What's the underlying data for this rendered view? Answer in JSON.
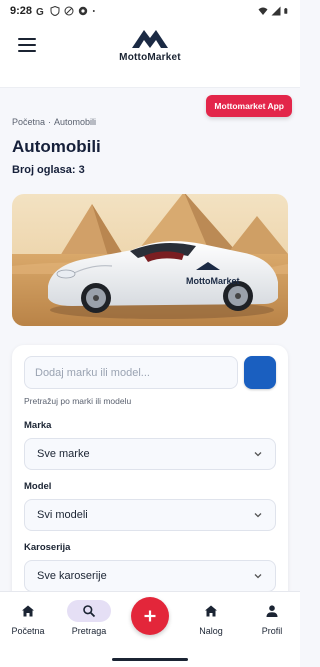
{
  "status_bar": {
    "time": "9:28",
    "left_icons": [
      "google-icon",
      "shield-icon",
      "vpn-icon",
      "soccer-icon",
      "dot-icon"
    ],
    "right_icons": [
      "wifi-icon",
      "signal-icon",
      "battery-icon"
    ]
  },
  "header": {
    "brand": "MottoMarket",
    "menu_icon": "hamburger-icon",
    "app_button": "Mottomarket App"
  },
  "breadcrumb": {
    "items": [
      "Početna",
      "Automobili"
    ],
    "separator": "·"
  },
  "page": {
    "title": "Automobili",
    "listing_count": "Broj oglasa: 3"
  },
  "hero": {
    "car_brand_text": "MottoMarket"
  },
  "filters": {
    "search": {
      "placeholder": "Dodaj marku ili model...",
      "value": "",
      "hint": "Pretražuj po marki ili modelu"
    },
    "brand": {
      "label": "Marka",
      "value": "Sve marke"
    },
    "model": {
      "label": "Model",
      "value": "Svi modeli"
    },
    "body_type": {
      "label": "Karoserija",
      "value": "Sve karoserije"
    }
  },
  "bottom_nav": {
    "items": [
      {
        "label": "Početna",
        "icon": "home-icon",
        "active": false
      },
      {
        "label": "Pretraga",
        "icon": "search-icon",
        "active": true
      },
      {
        "label": "Nalog",
        "icon": "home-icon",
        "active": false
      },
      {
        "label": "Profil",
        "icon": "person-icon",
        "active": false
      }
    ],
    "fab_icon": "plus-icon"
  },
  "colors": {
    "brand_navy": "#1b2433",
    "accent_red": "#e3264a",
    "accent_blue": "#1a5fc0",
    "active_nav_bg": "#e5dff5"
  }
}
